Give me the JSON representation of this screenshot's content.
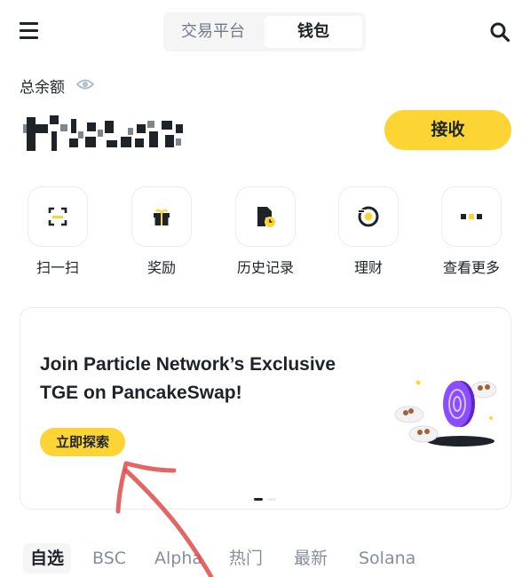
{
  "header": {
    "menu_icon": "hamburger-menu-icon",
    "tabs": [
      {
        "label": "交易平台",
        "active": false
      },
      {
        "label": "钱包",
        "active": true
      }
    ],
    "search_icon": "search-icon"
  },
  "balance": {
    "label": "总余额",
    "visibility_icon": "eye-icon",
    "value_obscured": true,
    "receive_button": "接收"
  },
  "quick_actions": [
    {
      "label": "扫一扫",
      "icon": "scan-icon"
    },
    {
      "label": "奖励",
      "icon": "gift-icon"
    },
    {
      "label": "历史记录",
      "icon": "history-icon"
    },
    {
      "label": "理财",
      "icon": "earn-icon"
    },
    {
      "label": "查看更多",
      "icon": "more-icon"
    }
  ],
  "banner": {
    "title_line1": "Join Particle Network’s Exclusive",
    "title_line2": "TGE on PancakeSwap!",
    "button": "立即探索",
    "page_indicator": {
      "current": 1,
      "total": 2
    }
  },
  "bottom_tabs": [
    {
      "label": "自选",
      "active": true
    },
    {
      "label": "BSC",
      "active": false
    },
    {
      "label": "Alpha",
      "active": false
    },
    {
      "label": "热门",
      "active": false
    },
    {
      "label": "最新",
      "active": false
    },
    {
      "label": "Solana",
      "active": false
    }
  ],
  "colors": {
    "accent": "#fcd535",
    "text": "#1e2329",
    "muted": "#848e9c",
    "annotation": "#e04a4a"
  }
}
